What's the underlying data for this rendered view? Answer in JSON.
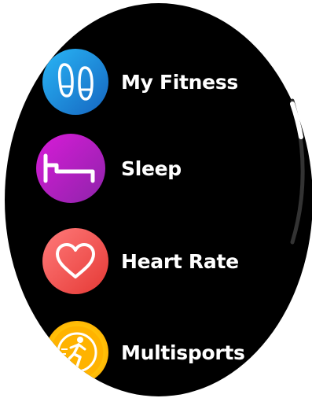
{
  "menu": {
    "items": [
      {
        "label": "My Fitness",
        "icon": "footprints-icon",
        "color_start": "#29b6f6",
        "color_end": "#1565c0"
      },
      {
        "label": "Sleep",
        "icon": "bed-icon",
        "color_start": "#d81bd8",
        "color_end": "#8e24aa"
      },
      {
        "label": "Heart Rate",
        "icon": "heart-icon",
        "color_start": "#ff6f6f",
        "color_end": "#e53935"
      },
      {
        "label": "Multisports",
        "icon": "running-person-icon",
        "color_start": "#ffc107",
        "color_end": "#ff9800"
      }
    ]
  },
  "scrollbar": {
    "thumb_color": "#ffffff",
    "track_color": "#3a3a3a"
  }
}
